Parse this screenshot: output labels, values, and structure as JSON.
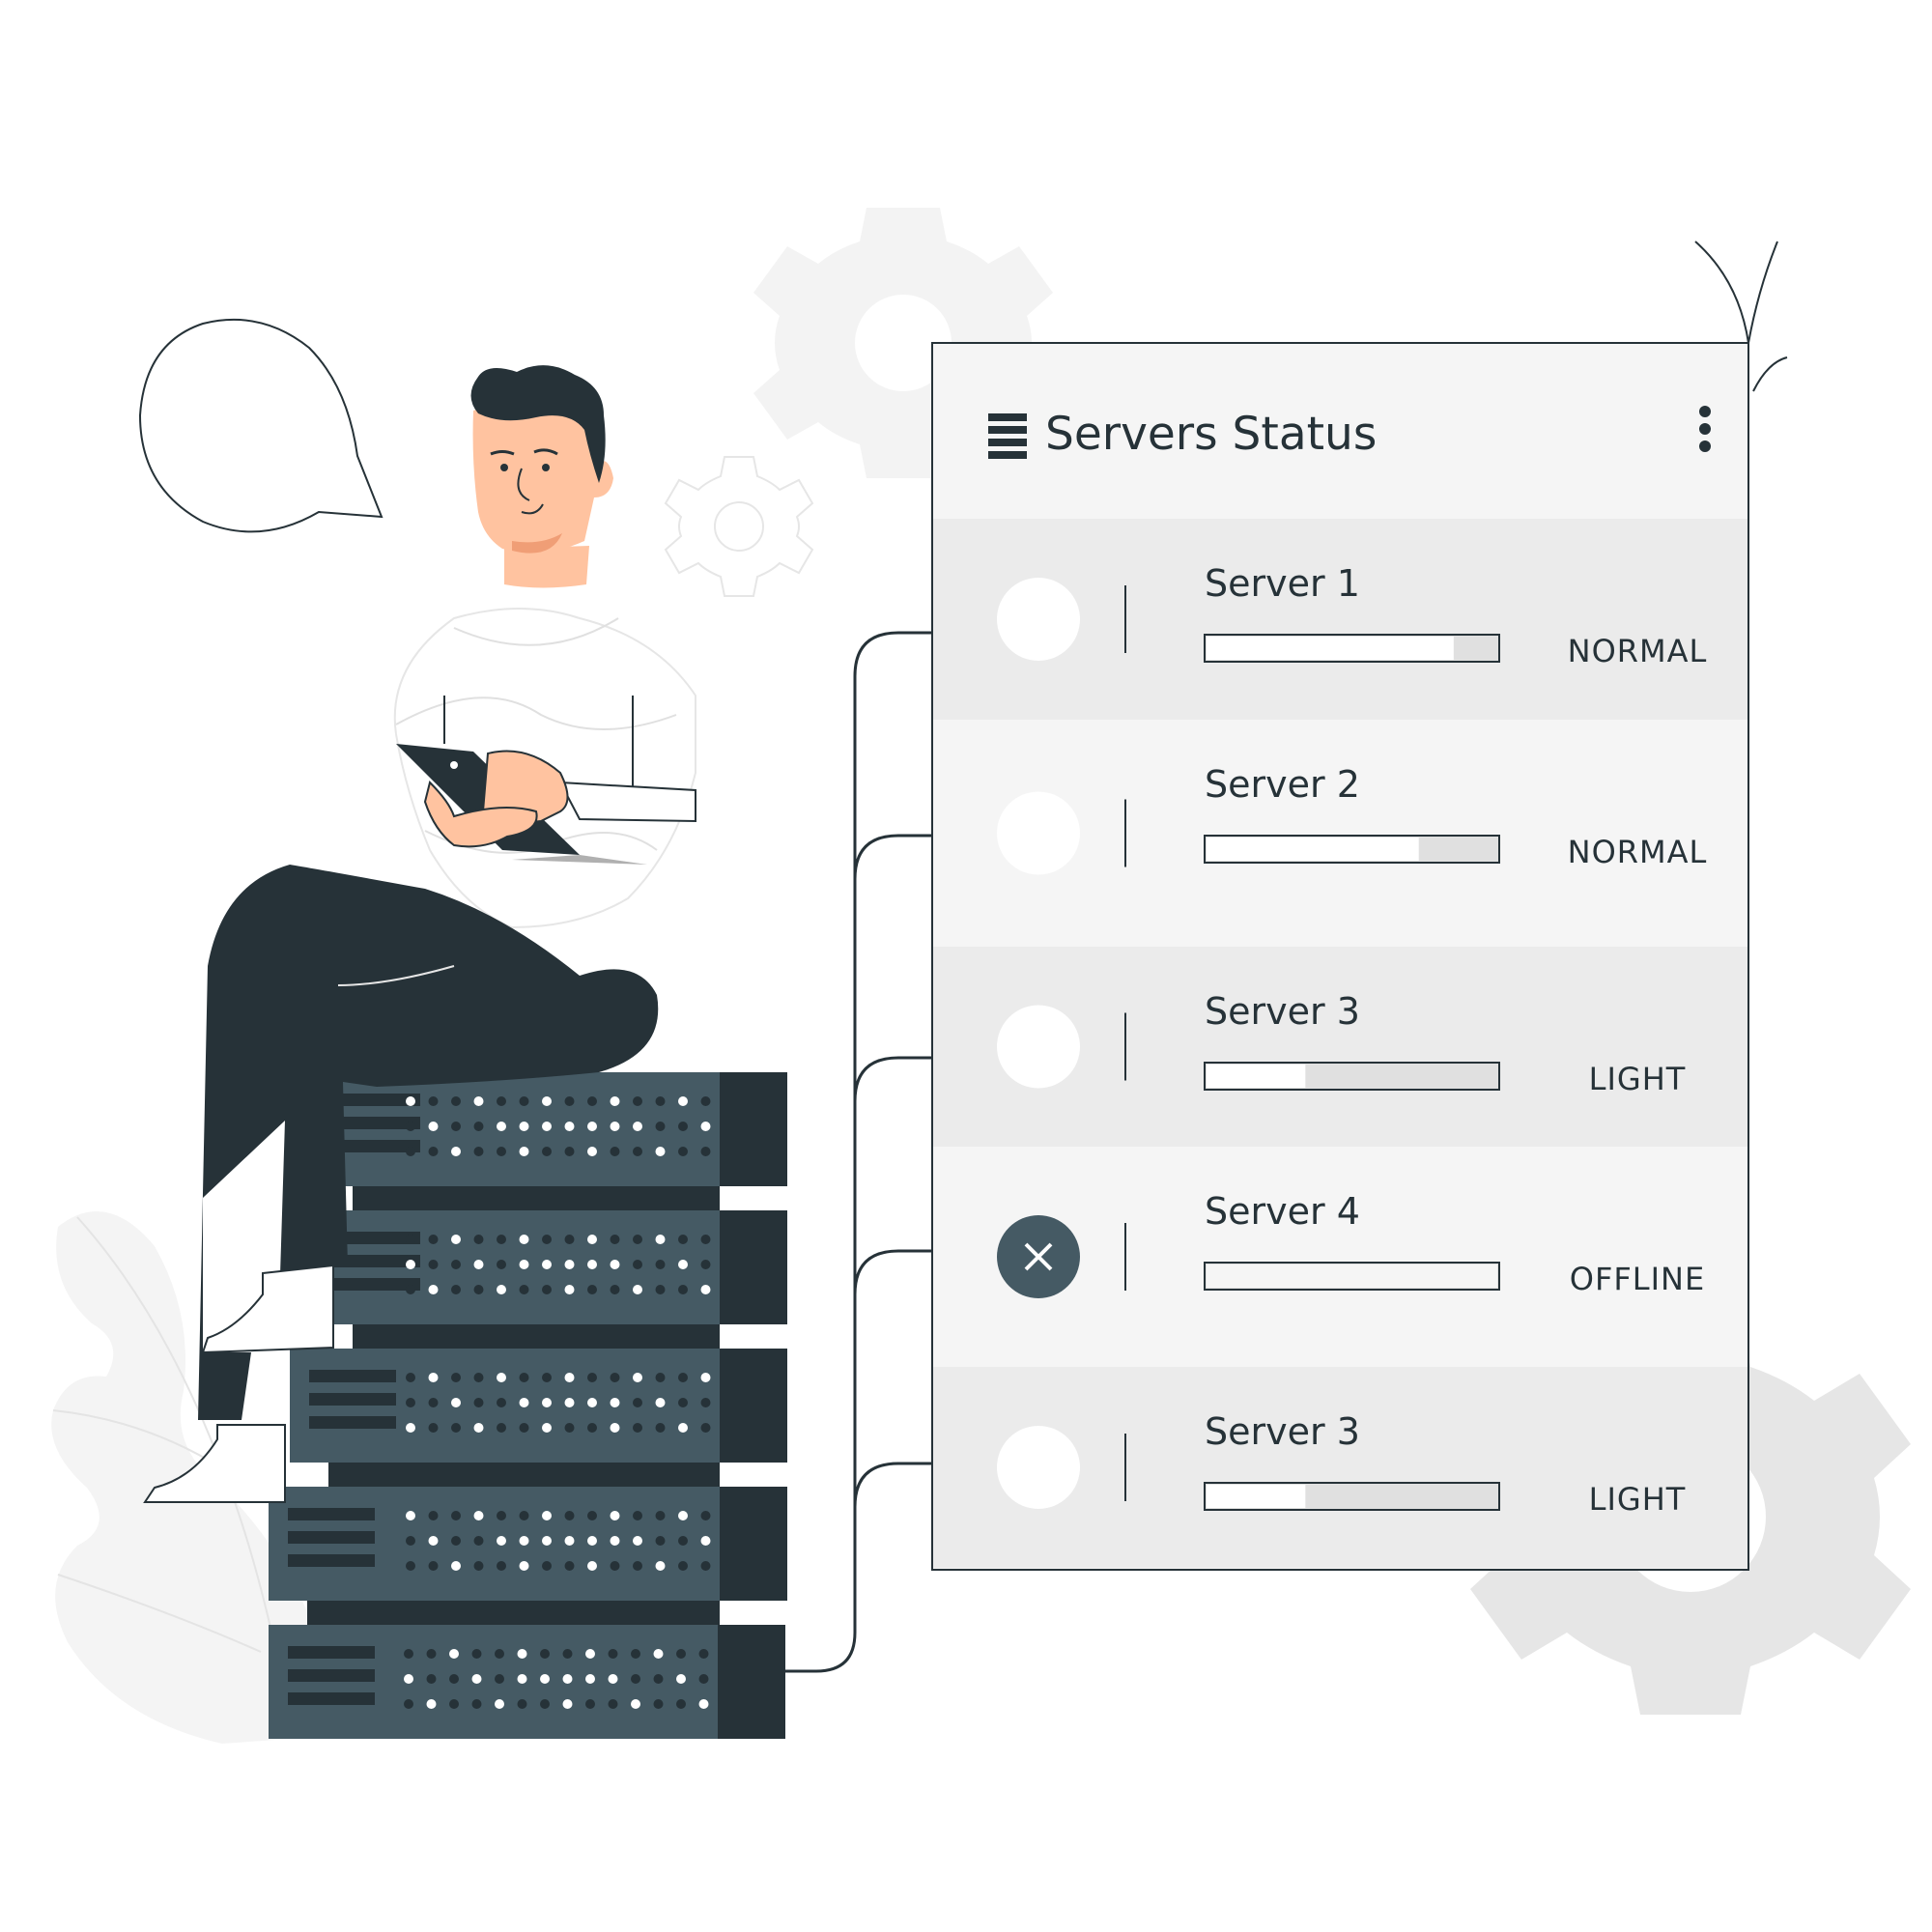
{
  "panel": {
    "title": "Servers Status",
    "title_icon": "server-list-icon",
    "menu_icon": "more-vertical-icon"
  },
  "servers": [
    {
      "name": "Server 1",
      "status": "NORMAL",
      "load": 0.85,
      "state": "online"
    },
    {
      "name": "Server 2",
      "status": "NORMAL",
      "load": 0.73,
      "state": "online"
    },
    {
      "name": "Server 3",
      "status": "LIGHT",
      "load": 0.34,
      "state": "online"
    },
    {
      "name": "Server 4",
      "status": "OFFLINE",
      "load": 0.0,
      "state": "offline",
      "state_icon": "close-icon"
    },
    {
      "name": "Server 3",
      "status": "LIGHT",
      "load": 0.34,
      "state": "online"
    }
  ],
  "colors": {
    "dark": "#263238",
    "server_face": "#455a64",
    "panel_bg": "#f5f5f5",
    "row_alt_bg": "#ebebeb",
    "skin": "#ffc3a0",
    "gear": "#f0f0f0"
  }
}
